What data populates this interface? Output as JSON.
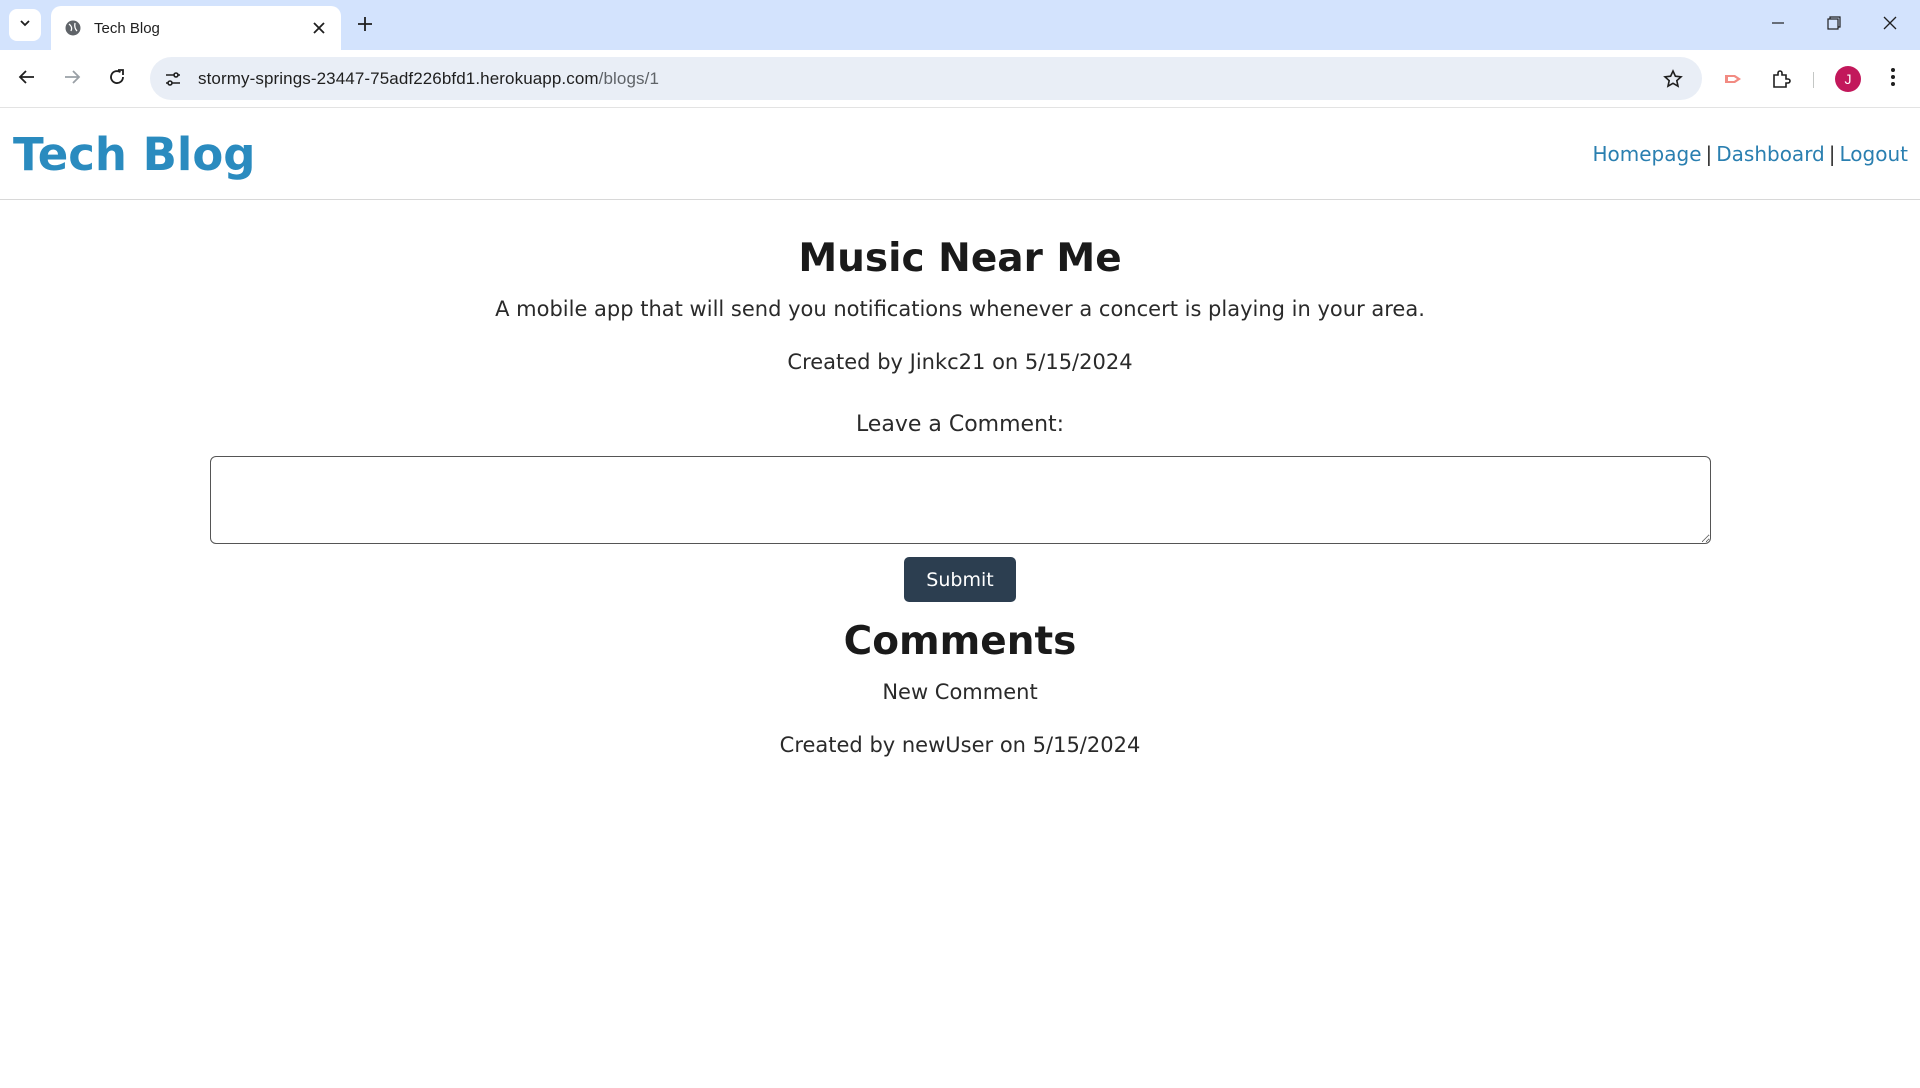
{
  "browser": {
    "tab_title": "Tech Blog",
    "url_host": "stormy-springs-23447-75adf226bfd1.herokuapp.com",
    "url_path": "/blogs/1",
    "avatar_initial": "J",
    "avatar_color": "#c2185b"
  },
  "header": {
    "brand": "Tech Blog",
    "nav": {
      "homepage": "Homepage",
      "dashboard": "Dashboard",
      "logout": "Logout",
      "separator": "|"
    }
  },
  "post": {
    "title": "Music Near Me",
    "body": "A mobile app that will send you notifications whenever a concert is playing in your area.",
    "meta": "Created by Jinkc21 on 5/15/2024"
  },
  "comment_form": {
    "label": "Leave a Comment:",
    "value": "",
    "submit_label": "Submit"
  },
  "comments": {
    "title": "Comments",
    "items": [
      {
        "text": "New Comment",
        "meta": "Created by newUser on 5/15/2024"
      }
    ]
  },
  "colors": {
    "brand": "#2a8bbf",
    "link": "#2a7fb0",
    "button": "#2c3e50",
    "tabstrip": "#d3e3fd"
  }
}
